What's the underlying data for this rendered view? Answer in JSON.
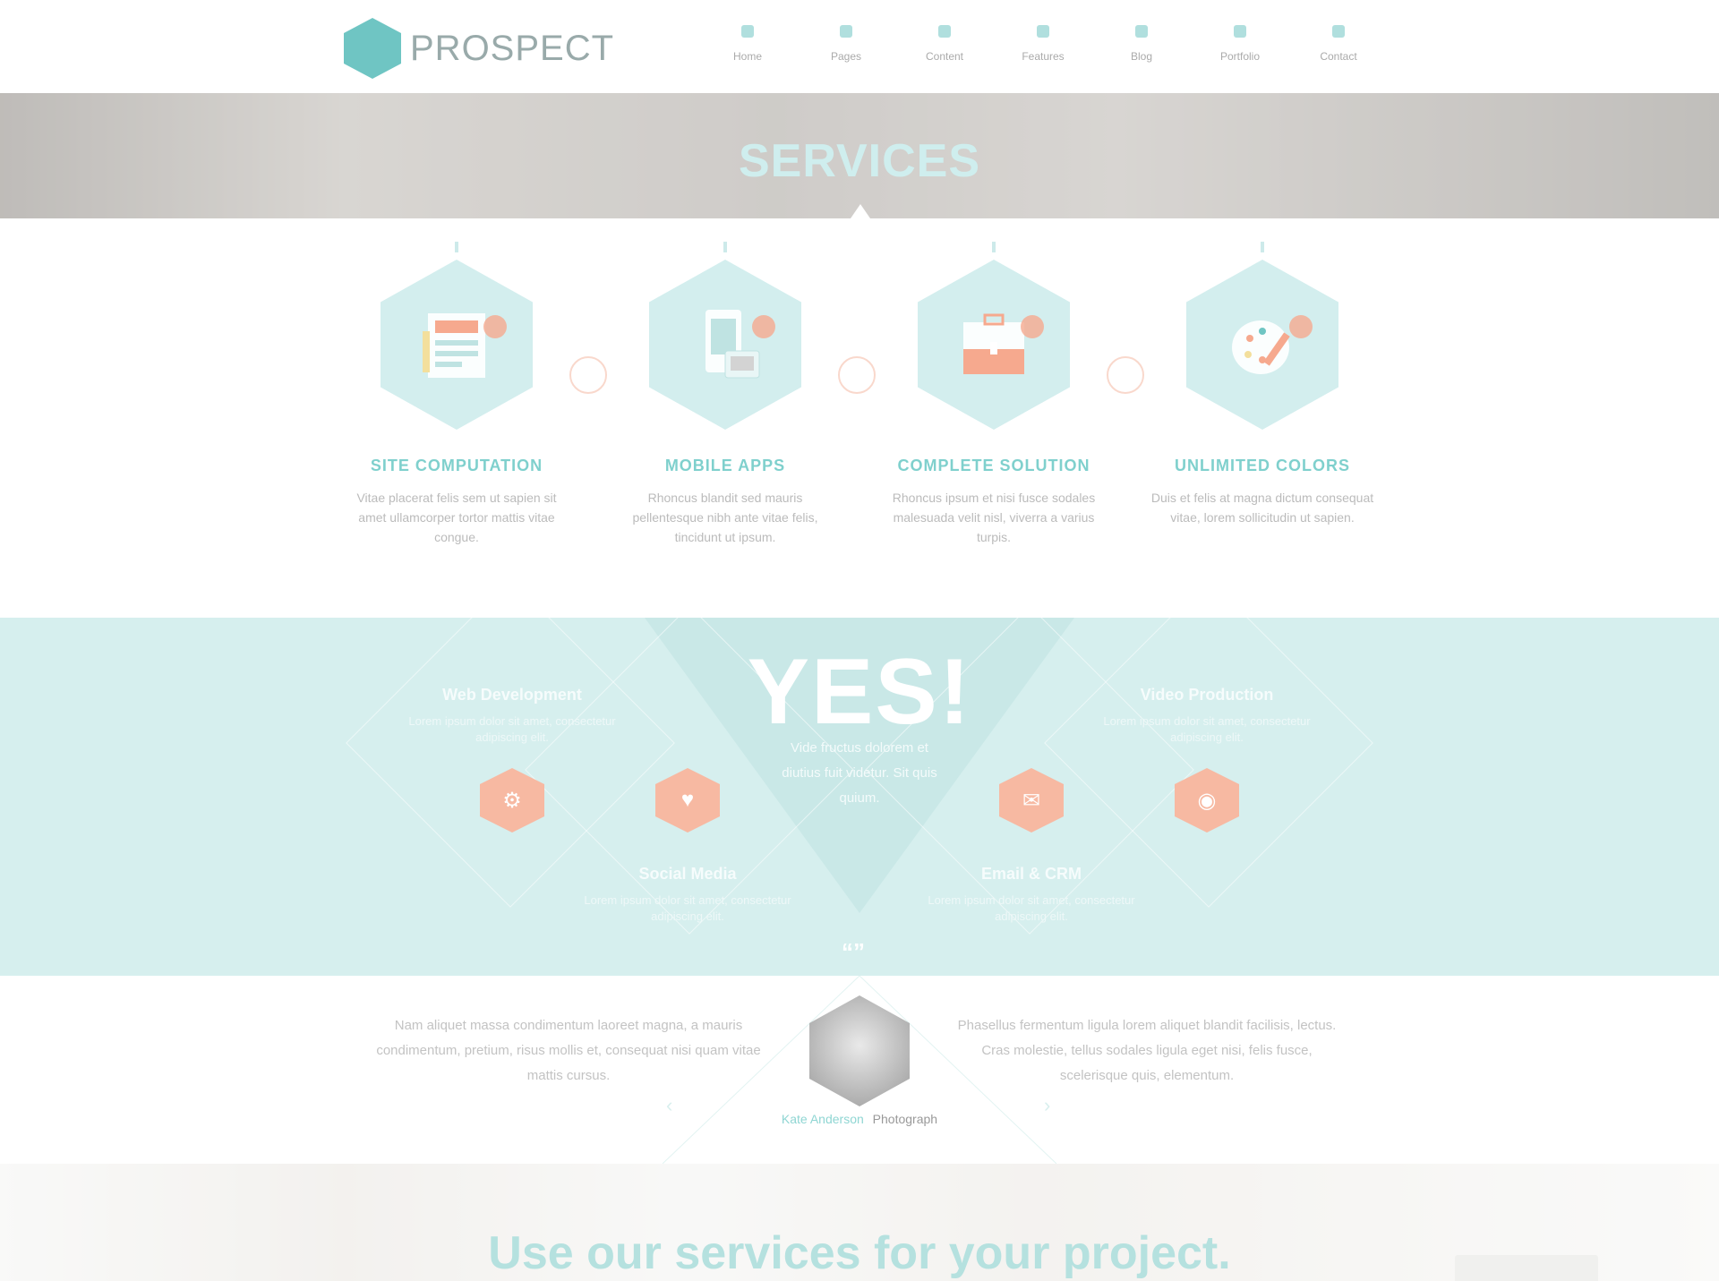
{
  "header": {
    "logo_text": "PROSPECT",
    "nav": [
      {
        "label": "Home",
        "icon": "home-icon"
      },
      {
        "label": "Pages",
        "icon": "pages-icon"
      },
      {
        "label": "Content",
        "icon": "content-icon"
      },
      {
        "label": "Features",
        "icon": "features-icon"
      },
      {
        "label": "Blog",
        "icon": "blog-icon"
      },
      {
        "label": "Portfolio",
        "icon": "portfolio-icon"
      },
      {
        "label": "Contact",
        "icon": "contact-icon"
      }
    ]
  },
  "banner": {
    "title": "SERVICES"
  },
  "features": [
    {
      "title": "SITE COMPUTATION",
      "text": "Vitae placerat felis sem ut sapien sit amet ullamcorper tortor mattis vitae congue."
    },
    {
      "title": "MOBILE APPS",
      "text": "Rhoncus blandit sed mauris pellentesque nibh ante vitae felis, tincidunt ut ipsum."
    },
    {
      "title": "COMPLETE SOLUTION",
      "text": "Rhoncus ipsum et nisi fusce sodales malesuada velit nisl, viverra a varius turpis."
    },
    {
      "title": "UNLIMITED COLORS",
      "text": "Duis et felis at magna dictum consequat vitae, lorem sollicitudin ut sapien."
    }
  ],
  "band": {
    "yes": "YES!",
    "yes_text": "Vide fructus dolorem et diutius fuit videtur. Sit quis quium.",
    "services": [
      {
        "title": "Web Development",
        "text": "Lorem ipsum dolor sit amet, consectetur adipiscing elit."
      },
      {
        "title": "Social Media",
        "text": "Lorem ipsum dolor sit amet, consectetur adipiscing elit."
      },
      {
        "title": "Email & CRM",
        "text": "Lorem ipsum dolor sit amet, consectetur adipiscing elit."
      },
      {
        "title": "Video Production",
        "text": "Lorem ipsum dolor sit amet, consectetur adipiscing elit."
      }
    ]
  },
  "testimonial": {
    "left_quote": "Nam aliquet massa condimentum laoreet magna, a mauris condimentum, pretium, risus mollis et, consequat nisi quam vitae mattis cursus.",
    "right_quote": "Phasellus fermentum ligula lorem aliquet blandit facilisis, lectus. Cras molestie, tellus sodales ligula eget nisi, felis fusce, scelerisque quis, elementum.",
    "author_name": "Kate Anderson",
    "author_role": "Photograph"
  },
  "cta": {
    "title": "Use our services for your project."
  },
  "colors": {
    "accent": "#6fc5c3",
    "band": "#d6efee",
    "coral": "#f6a98e"
  }
}
